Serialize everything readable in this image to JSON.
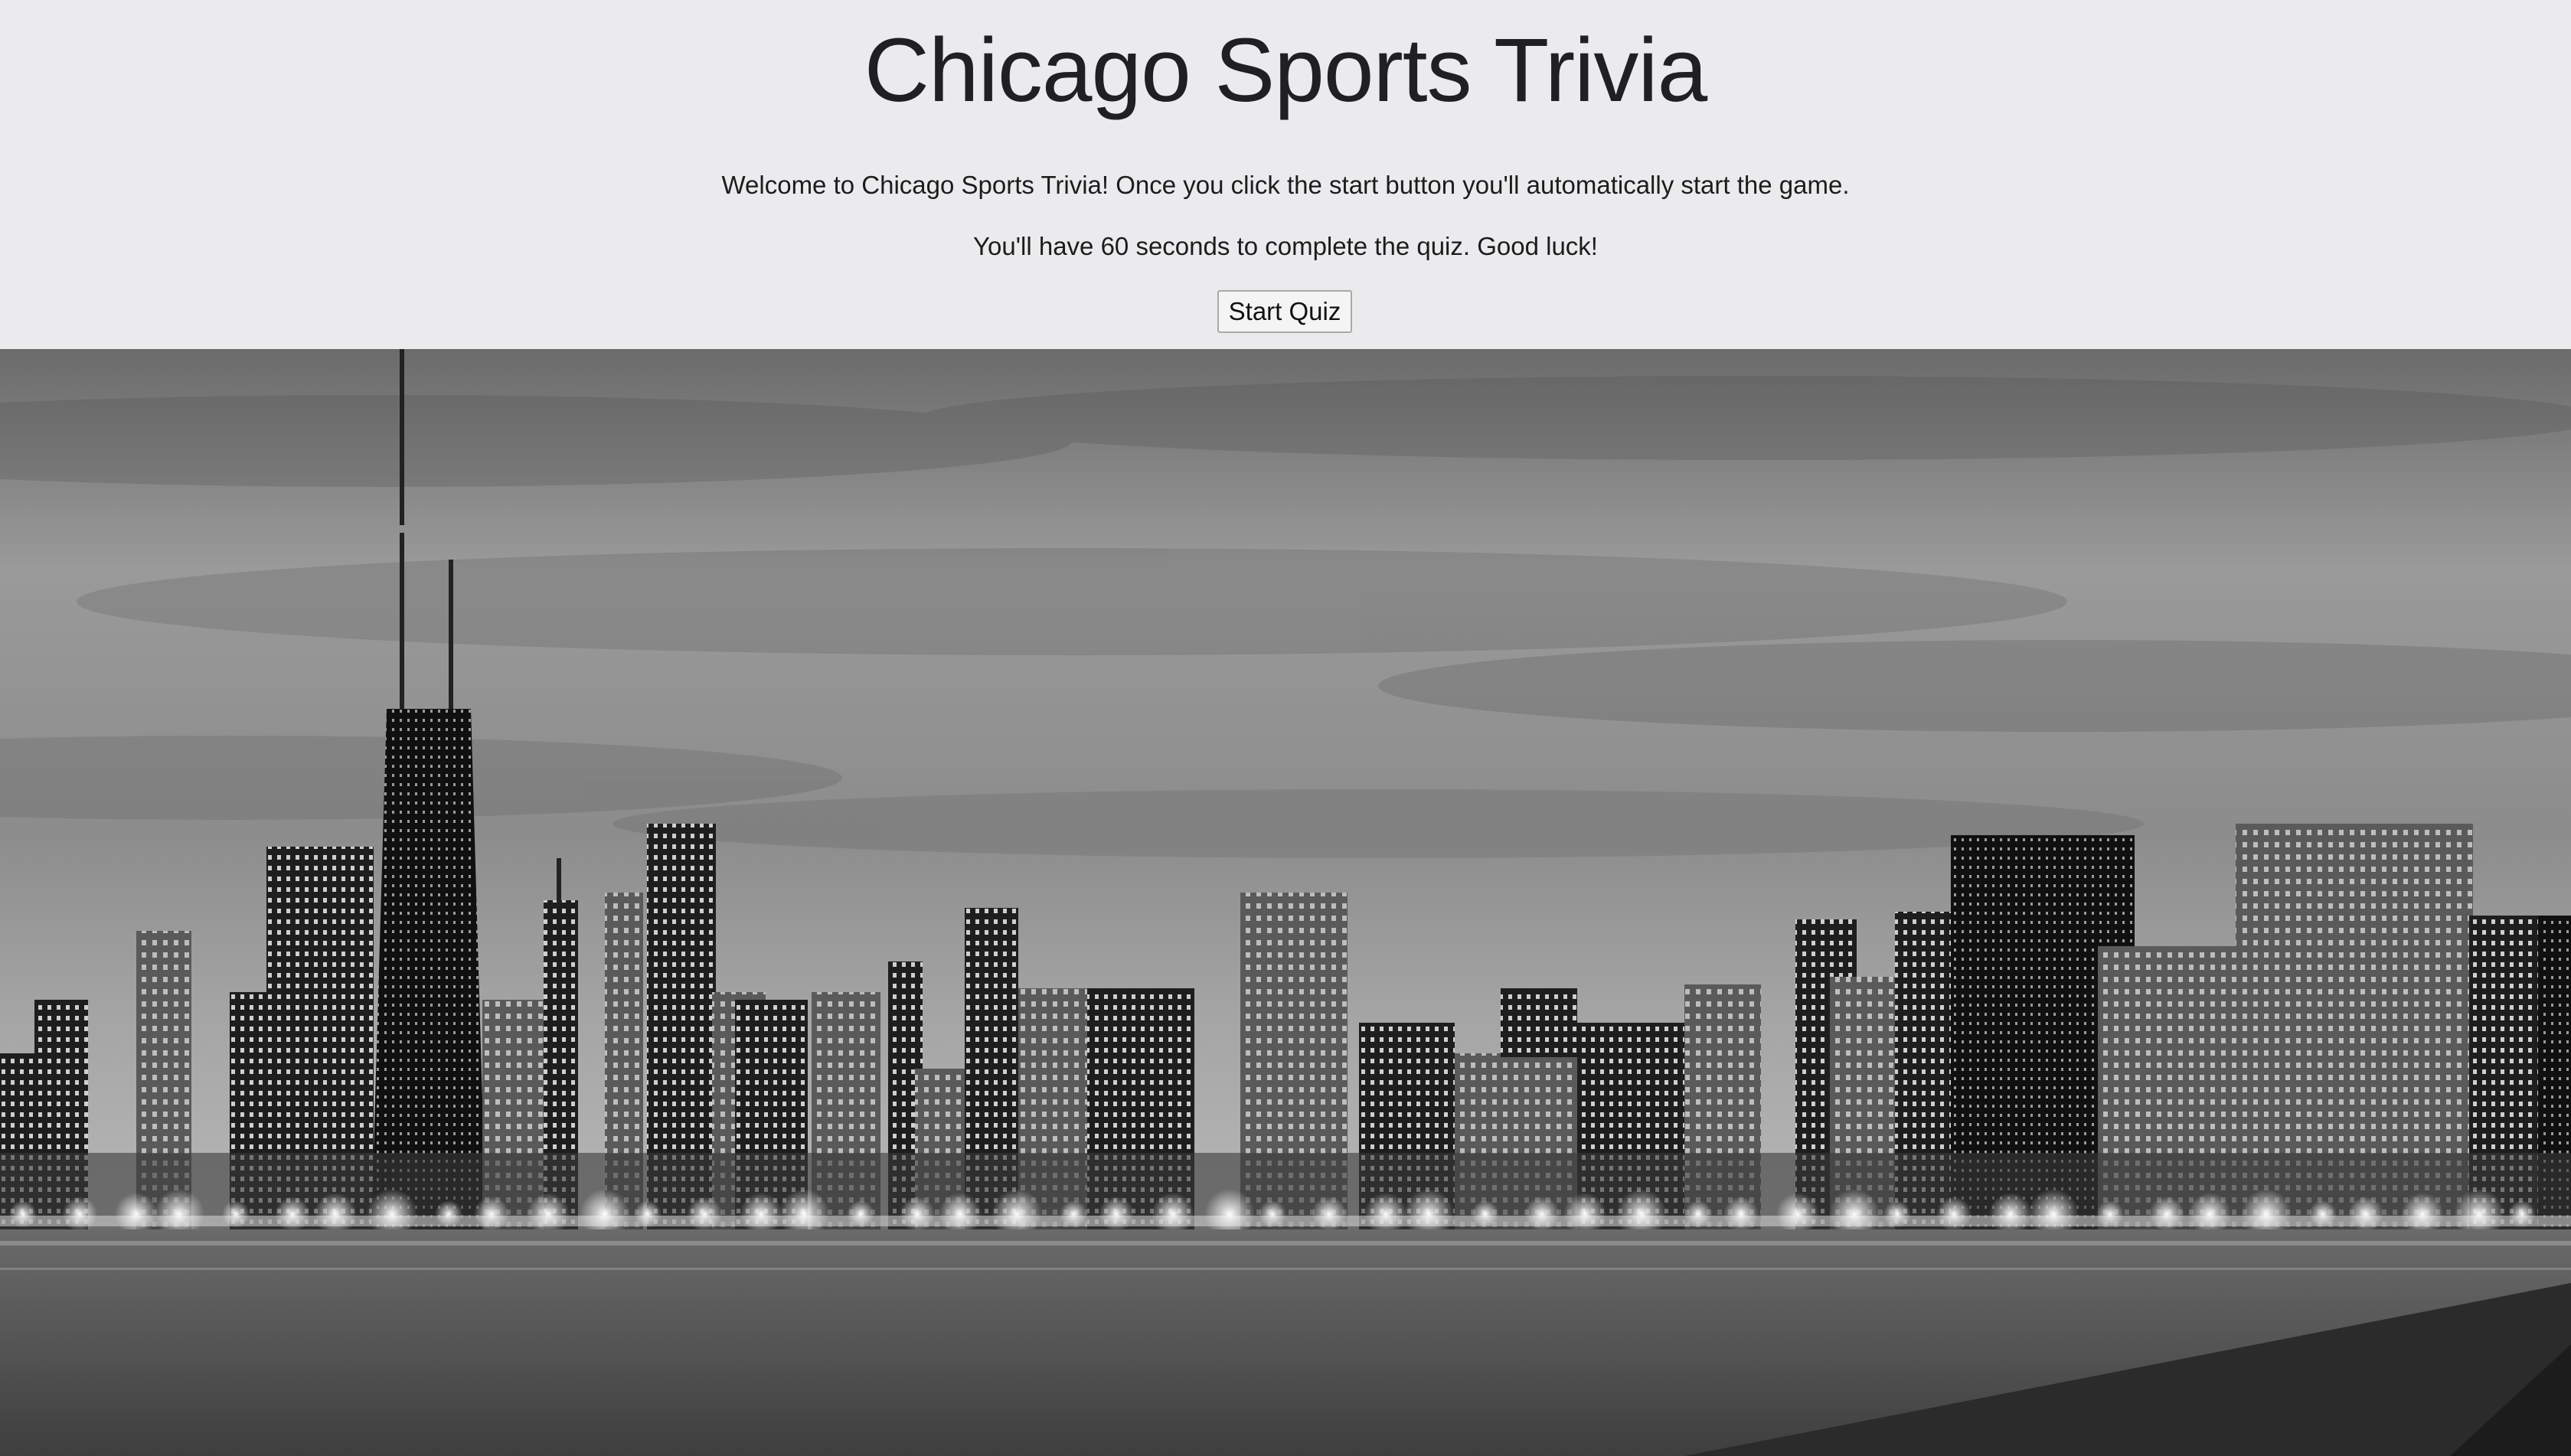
{
  "page": {
    "title": "Chicago Sports Trivia",
    "intro_line_1": "Welcome to Chicago Sports Trivia! Once you click the start button you'll automatically start the game.",
    "intro_line_2": "You'll have 60 seconds to complete the quiz. Good luck!",
    "start_button_label": "Start Quiz"
  },
  "hero": {
    "subject": "Chicago skyline at night, black and white, reflected on the lake"
  },
  "colors": {
    "header_background": "#ebebee",
    "title_text": "#1f1f24",
    "button_background": "#f4f4f4"
  }
}
